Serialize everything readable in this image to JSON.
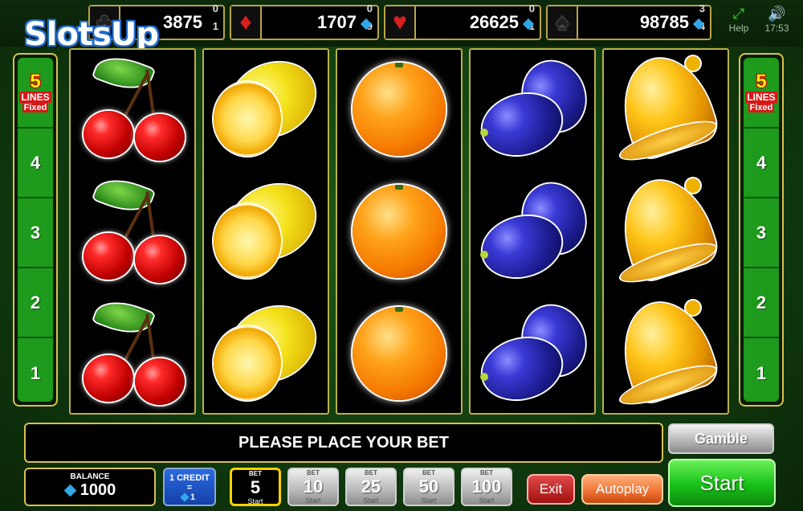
{
  "brand": {
    "logo_text": "SlotsUp"
  },
  "jackpots": [
    {
      "suit": "clubs",
      "symbol": "♣",
      "value": "3875",
      "digit_top": "0",
      "digit_bottom": "1"
    },
    {
      "suit": "diamonds",
      "symbol": "♦",
      "value": "1707",
      "digit_top": "0",
      "digit_bottom": "9"
    },
    {
      "suit": "hearts",
      "symbol": "♥",
      "value": "26625",
      "digit_top": "0",
      "digit_bottom": "1"
    },
    {
      "suit": "spades",
      "symbol": "♠",
      "value": "98785",
      "digit_top": "3",
      "digit_bottom": "4"
    }
  ],
  "top_right": {
    "help_label": "Help",
    "help_icon": "fullscreen-icon",
    "time": "17:53",
    "sound_icon": "speaker-icon"
  },
  "lines_panel": {
    "count": "5",
    "word": "LINES",
    "fixed": "Fixed",
    "lines": [
      "4",
      "3",
      "2",
      "1"
    ]
  },
  "reels": [
    {
      "symbol": "cherries",
      "rows": [
        "cherries",
        "cherries",
        "cherries"
      ]
    },
    {
      "symbol": "lemon",
      "rows": [
        "lemon",
        "lemon",
        "lemon"
      ]
    },
    {
      "symbol": "orange",
      "rows": [
        "orange",
        "orange",
        "orange"
      ]
    },
    {
      "symbol": "plum",
      "rows": [
        "plum",
        "plum",
        "plum"
      ]
    },
    {
      "symbol": "bell",
      "rows": [
        "bell",
        "bell",
        "bell"
      ]
    }
  ],
  "message": "PLEASE PLACE YOUR BET",
  "gamble_label": "Gamble",
  "balance": {
    "label": "BALANCE",
    "value": "1000"
  },
  "credit": {
    "label": "1 CREDIT",
    "eq": "=",
    "value": "1"
  },
  "bets": [
    {
      "label": "BET",
      "value": "5",
      "sub": "Start",
      "active": true
    },
    {
      "label": "BET",
      "value": "10",
      "sub": "Start",
      "active": false
    },
    {
      "label": "BET",
      "value": "25",
      "sub": "Start",
      "active": false
    },
    {
      "label": "BET",
      "value": "50",
      "sub": "Start",
      "active": false
    },
    {
      "label": "BET",
      "value": "100",
      "sub": "Start",
      "active": false
    }
  ],
  "exit_label": "Exit",
  "autoplay_label": "Autoplay",
  "start_label": "Start",
  "colors": {
    "accent_gold": "#d7c24f",
    "start_green": "#18c018",
    "credit_blue": "#1d5ad0",
    "exit_red": "#c21e1e",
    "autoplay_orange": "#f07030"
  }
}
